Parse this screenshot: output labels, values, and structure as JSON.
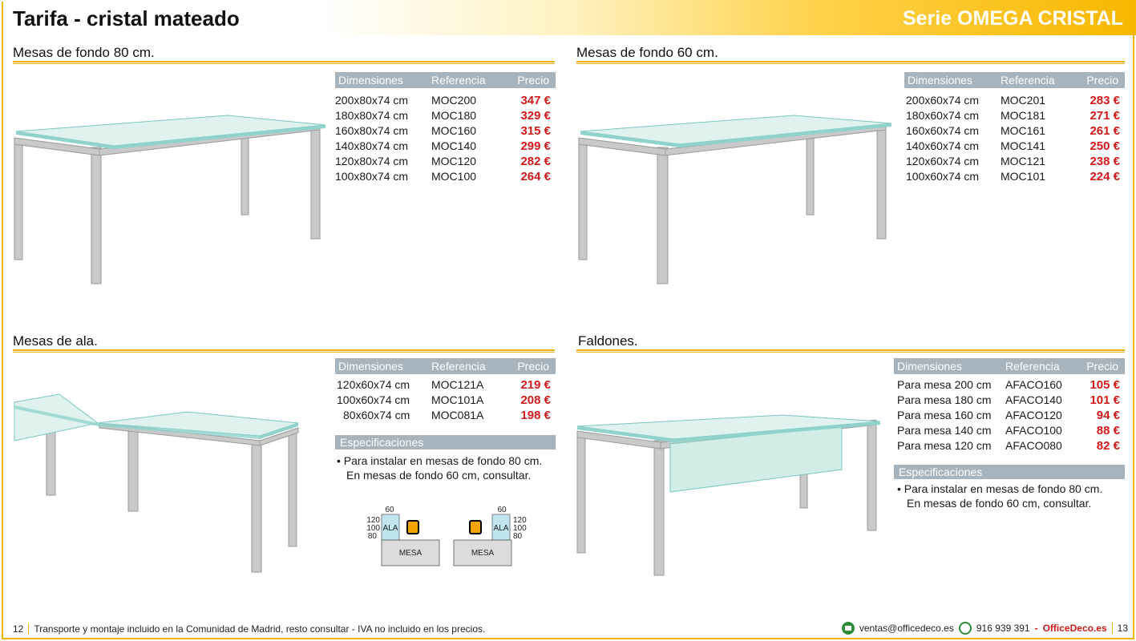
{
  "header": {
    "title": "Tarifa - cristal mateado",
    "series": "Serie OMEGA CRISTAL"
  },
  "colors": {
    "accent": "#f2b01e",
    "table_header": "#a7b3bd",
    "price": "#d11a1a"
  },
  "columns": {
    "dim": "Dimensiones",
    "ref": "Referencia",
    "price": "Precio"
  },
  "sections": {
    "fondo80": {
      "title": "Mesas de fondo 80 cm.",
      "rows": [
        {
          "dim": "200x80x74 cm",
          "ref": "MOC200",
          "price": "347 €"
        },
        {
          "dim": "180x80x74 cm",
          "ref": "MOC180",
          "price": "329 €"
        },
        {
          "dim": "160x80x74 cm",
          "ref": "MOC160",
          "price": "315 €"
        },
        {
          "dim": "140x80x74 cm",
          "ref": "MOC140",
          "price": "299 €"
        },
        {
          "dim": "120x80x74 cm",
          "ref": "MOC120",
          "price": "282 €"
        },
        {
          "dim": "100x80x74 cm",
          "ref": "MOC100",
          "price": "264 €"
        }
      ]
    },
    "fondo60": {
      "title": "Mesas de fondo 60 cm.",
      "rows": [
        {
          "dim": "200x60x74 cm",
          "ref": "MOC201",
          "price": "283 €"
        },
        {
          "dim": "180x60x74 cm",
          "ref": "MOC181",
          "price": "271 €"
        },
        {
          "dim": "160x60x74 cm",
          "ref": "MOC161",
          "price": "261 €"
        },
        {
          "dim": "140x60x74 cm",
          "ref": "MOC141",
          "price": "250 €"
        },
        {
          "dim": "120x60x74 cm",
          "ref": "MOC121",
          "price": "238 €"
        },
        {
          "dim": "100x60x74 cm",
          "ref": "MOC101",
          "price": "224 €"
        }
      ]
    },
    "ala": {
      "title": "Mesas de ala.",
      "rows": [
        {
          "dim": "120x60x74 cm",
          "ref": "MOC121A",
          "price": "219 €"
        },
        {
          "dim": "100x60x74 cm",
          "ref": "MOC101A",
          "price": "208 €"
        },
        {
          "dim": "80x60x74 cm",
          "ref": "MOC081A",
          "price": "198 €"
        }
      ],
      "spec_title": "Especificaciones",
      "spec_line1": "• Para instalar en mesas de fondo 80 cm.",
      "spec_line2": "En mesas de fondo 60 cm, consultar.",
      "diagram": {
        "w60": "60",
        "n120": "120",
        "n100": "100",
        "n80": "80",
        "ala": "ALA",
        "mesa": "MESA"
      }
    },
    "faldones": {
      "title": "Faldones.",
      "rows": [
        {
          "dim": "Para mesa 200 cm",
          "ref": "AFACO160",
          "price": "105 €"
        },
        {
          "dim": "Para mesa 180 cm",
          "ref": "AFACO140",
          "price": "101 €"
        },
        {
          "dim": "Para mesa 160 cm",
          "ref": "AFACO120",
          "price": "94 €"
        },
        {
          "dim": "Para mesa 140 cm",
          "ref": "AFACO100",
          "price": "88 €"
        },
        {
          "dim": "Para mesa 120 cm",
          "ref": "AFACO080",
          "price": "82 €"
        }
      ],
      "spec_title": "Especificaciones",
      "spec_line1": "• Para instalar en mesas de fondo 80 cm.",
      "spec_line2": "En mesas de fondo 60 cm, consultar."
    }
  },
  "footer": {
    "page_left": "12",
    "note": "Transporte y montaje incluido en la Comunidad de Madrid, resto consultar - IVA no incluido en los precios.",
    "email": "ventas@officedeco.es",
    "phone": "916 939 391",
    "sep": "-",
    "brand": "OfficeDeco.es",
    "page_right": "13"
  }
}
